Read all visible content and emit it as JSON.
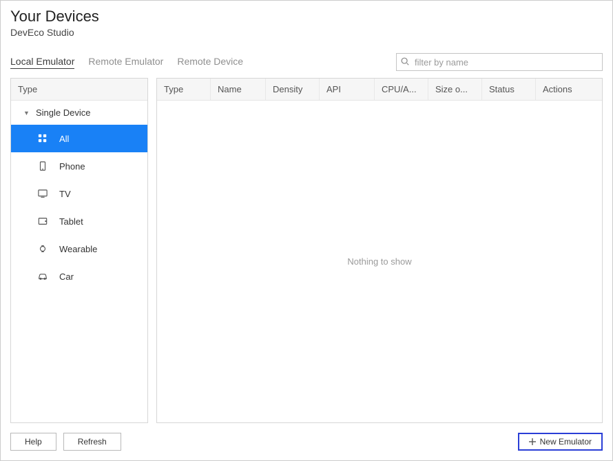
{
  "header": {
    "title": "Your Devices",
    "subtitle": "DevEco Studio"
  },
  "tabs": [
    {
      "label": "Local Emulator",
      "active": true
    },
    {
      "label": "Remote Emulator",
      "active": false
    },
    {
      "label": "Remote Device",
      "active": false
    }
  ],
  "filter": {
    "placeholder": "filter by name",
    "value": ""
  },
  "sidebar": {
    "header": "Type",
    "group": "Single Device",
    "items": [
      {
        "label": "All",
        "icon": "grid-icon",
        "selected": true
      },
      {
        "label": "Phone",
        "icon": "phone-icon",
        "selected": false
      },
      {
        "label": "TV",
        "icon": "tv-icon",
        "selected": false
      },
      {
        "label": "Tablet",
        "icon": "tablet-icon",
        "selected": false
      },
      {
        "label": "Wearable",
        "icon": "wearable-icon",
        "selected": false
      },
      {
        "label": "Car",
        "icon": "car-icon",
        "selected": false
      }
    ]
  },
  "table": {
    "columns": [
      "Type",
      "Name",
      "Density",
      "API",
      "CPU/A...",
      "Size o...",
      "Status",
      "Actions"
    ],
    "empty": "Nothing to show"
  },
  "footer": {
    "help": "Help",
    "refresh": "Refresh",
    "new_emulator": "New Emulator"
  }
}
